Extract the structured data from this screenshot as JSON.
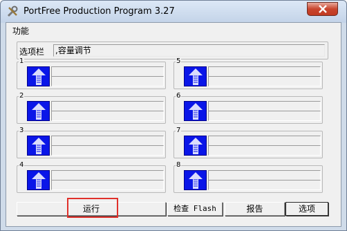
{
  "window": {
    "title": "PortFree Production Program 3.27"
  },
  "menu": {
    "items": [
      "功能"
    ]
  },
  "options": {
    "label": "选项栏",
    "value": ",容量调节"
  },
  "ports": [
    {
      "number": "1"
    },
    {
      "number": "2"
    },
    {
      "number": "3"
    },
    {
      "number": "4"
    },
    {
      "number": "5"
    },
    {
      "number": "6"
    },
    {
      "number": "7"
    },
    {
      "number": "8"
    }
  ],
  "buttons": {
    "run": "运行",
    "check_flash": "检查 Flash",
    "report": "报告",
    "options": "选项"
  },
  "colors": {
    "port_icon": "#0a16e8",
    "close_button": "#c8452d",
    "highlight": "#e0302a"
  }
}
